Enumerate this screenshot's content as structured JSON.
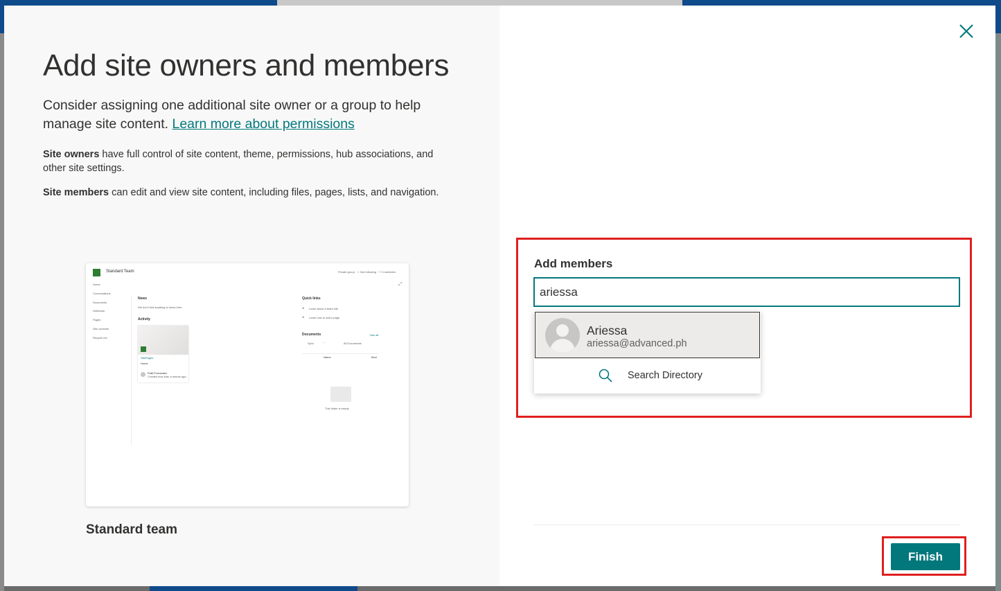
{
  "dialog": {
    "title": "Add site owners and members",
    "intro_text": "Consider assigning one additional site owner or a group to help manage site content.",
    "learn_more_link": "Learn more about permissions",
    "owners_label": "Site owners",
    "owners_desc": " have full control of site content, theme, permissions, hub associations, and other site settings.",
    "members_label": "Site members",
    "members_desc": " can edit and view site content, including files, pages, lists, and navigation.",
    "close_icon": "close-icon"
  },
  "preview": {
    "site_name": "Standard Team",
    "header_right": "Private group  ·  ☆ Not following  ·  ⚇ 3 members",
    "nav": [
      "Home",
      "Conversations",
      "Documents",
      "Notebook",
      "Pages",
      "Site contents",
      "Recycle bin"
    ],
    "news_heading": "News",
    "news_empty": "We don't find anything to show here.",
    "activity_heading": "Activity",
    "activity_file": "SitePages",
    "activity_subtitle": "Home",
    "activity_author": "Patti Fernandez",
    "activity_time": "Created less than a minute ago",
    "quick_links_heading": "Quick links",
    "quick_link_1": "Learn about a team site",
    "quick_link_2": "Learn how to add a page",
    "documents_heading": "Documents",
    "see_all": "See all",
    "sync": "Sync",
    "more": "···",
    "all_documents": "All Documents",
    "col_name": "Name",
    "col_modified": "Mod",
    "empty_folder": "This folder is empty",
    "caption": "Standard team"
  },
  "members": {
    "label": "Add members",
    "input_value": "ariessa",
    "suggestion": {
      "name": "Ariessa",
      "email": "ariessa@advanced.ph"
    },
    "search_directory": "Search Directory",
    "search_icon": "search-icon"
  },
  "footer": {
    "finish_label": "Finish"
  },
  "colors": {
    "accent": "#03787c",
    "highlight": "#e01f1f",
    "text": "#323130"
  }
}
